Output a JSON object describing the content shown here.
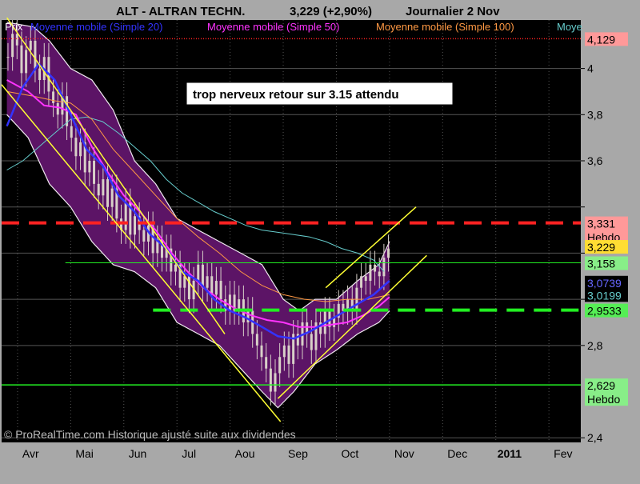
{
  "header": {
    "title": "ALT - ALTRAN TECHN.",
    "price": "3,229 (+2,90%)",
    "period": "Journalier  2 Nov"
  },
  "legend": [
    {
      "label": "Prix",
      "color": "#ffffff"
    },
    {
      "label": "Moyenne mobile (Simple 20)",
      "color": "#3333ff"
    },
    {
      "label": "Moyenne mobile (Simple 50)",
      "color": "#ff33ff"
    },
    {
      "label": "Moyenne mobile (Simple 100)",
      "color": "#ff9944"
    },
    {
      "label": "Moye",
      "color": "#66cccc"
    }
  ],
  "annotation": "trop nerveux  retour sur 3.15 attendu",
  "footer": "© ProRealTime.com Historique ajusté suite aux dividendes",
  "colors": {
    "background": "#000000",
    "frame": "#a8a8a8",
    "bollinger_fill": "#5c1466",
    "candle": "#d8d0c8",
    "ma20": "#3333ff",
    "ma50": "#ff33ff",
    "ma100": "#ff9944",
    "ma_other": "#66cccc",
    "resistance": "#ff2222",
    "support": "#22ee22",
    "channel": "#ffff33",
    "grid": "#555555"
  },
  "chart_data": {
    "type": "candlestick",
    "x_labels": [
      {
        "label": "Avr",
        "pos": 0.0
      },
      {
        "label": "Mai",
        "pos": 1.0
      },
      {
        "label": "Jun",
        "pos": 2.0
      },
      {
        "label": "Jul",
        "pos": 3.0
      },
      {
        "label": "Aou",
        "pos": 4.0
      },
      {
        "label": "Sep",
        "pos": 5.0
      },
      {
        "label": "Oct",
        "pos": 6.0
      },
      {
        "label": "Nov",
        "pos": 7.0
      },
      {
        "label": "Dec",
        "pos": 8.0
      },
      {
        "label": "2011",
        "pos": 9.0,
        "bold": true
      },
      {
        "label": "Fev",
        "pos": 10.0
      }
    ],
    "x_range": [
      -0.3,
      10.6
    ],
    "y_ticks": [
      {
        "value": 2.4,
        "label": "2,4"
      },
      {
        "value": 2.8,
        "label": "2,8"
      },
      {
        "value": 3.0,
        "label": ""
      },
      {
        "value": 3.2,
        "label": ""
      },
      {
        "value": 3.4,
        "label": ""
      },
      {
        "value": 3.6,
        "label": "3,6"
      },
      {
        "value": 3.8,
        "label": "3,8"
      },
      {
        "value": 4.0,
        "label": "4"
      }
    ],
    "ylim": [
      2.38,
      4.21
    ],
    "price_tags": [
      {
        "value": 4.129,
        "label": "4,129",
        "bg": "#ff9999",
        "fg": "#000000"
      },
      {
        "value": 3.331,
        "label": "3,331\nHebdo",
        "bg": "#ff9999",
        "fg": "#000000"
      },
      {
        "value": 3.229,
        "label": "3,229",
        "bg": "#ffdd33",
        "fg": "#000000"
      },
      {
        "value": 3.158,
        "label": "3,158",
        "bg": "#88ee88",
        "fg": "#000000"
      },
      {
        "value": 3.0739,
        "label": "3,0739",
        "bg": "#000000",
        "fg": "#6666ff"
      },
      {
        "value": 3.0199,
        "label": "3,0199",
        "bg": "#000000",
        "fg": "#66cccc"
      },
      {
        "value": 2.9533,
        "label": "2,9533",
        "bg": "#55ee55",
        "fg": "#000000"
      },
      {
        "value": 2.629,
        "label": "2,629\nHebdo",
        "bg": "#88ee88",
        "fg": "#000000"
      }
    ],
    "resistance_level": 3.331,
    "support_level": 2.9533,
    "level_3158": 3.158,
    "level_2629": 2.629,
    "upper_bar_level": 4.129,
    "bb_upper": [
      [
        -0.2,
        4.2
      ],
      [
        0.3,
        4.18
      ],
      [
        0.6,
        4.12
      ],
      [
        1.0,
        4.0
      ],
      [
        1.4,
        3.95
      ],
      [
        1.8,
        3.82
      ],
      [
        2.2,
        3.6
      ],
      [
        2.6,
        3.5
      ],
      [
        3.0,
        3.35
      ],
      [
        3.4,
        3.3
      ],
      [
        3.8,
        3.25
      ],
      [
        4.2,
        3.2
      ],
      [
        4.6,
        3.15
      ],
      [
        5.0,
        3.0
      ],
      [
        5.3,
        2.95
      ],
      [
        5.6,
        3.0
      ],
      [
        6.0,
        3.0
      ],
      [
        6.4,
        3.08
      ],
      [
        6.8,
        3.15
      ],
      [
        7.0,
        3.25
      ]
    ],
    "bb_lower": [
      [
        -0.2,
        3.8
      ],
      [
        0.2,
        3.7
      ],
      [
        0.6,
        3.5
      ],
      [
        1.0,
        3.4
      ],
      [
        1.4,
        3.25
      ],
      [
        1.8,
        3.15
      ],
      [
        2.2,
        3.12
      ],
      [
        2.6,
        3.05
      ],
      [
        3.0,
        2.9
      ],
      [
        3.4,
        2.85
      ],
      [
        3.8,
        2.8
      ],
      [
        4.2,
        2.7
      ],
      [
        4.6,
        2.6
      ],
      [
        4.9,
        2.53
      ],
      [
        5.2,
        2.6
      ],
      [
        5.6,
        2.72
      ],
      [
        6.0,
        2.78
      ],
      [
        6.4,
        2.85
      ],
      [
        6.8,
        2.9
      ],
      [
        7.0,
        2.95
      ]
    ],
    "ma20": [
      [
        -0.2,
        3.75
      ],
      [
        0.1,
        3.92
      ],
      [
        0.4,
        4.02
      ],
      [
        0.7,
        3.95
      ],
      [
        1.0,
        3.8
      ],
      [
        1.3,
        3.65
      ],
      [
        1.6,
        3.58
      ],
      [
        1.9,
        3.45
      ],
      [
        2.2,
        3.38
      ],
      [
        2.5,
        3.28
      ],
      [
        2.8,
        3.22
      ],
      [
        3.1,
        3.12
      ],
      [
        3.4,
        3.08
      ],
      [
        3.7,
        3.0
      ],
      [
        4.0,
        2.95
      ],
      [
        4.3,
        2.92
      ],
      [
        4.6,
        2.88
      ],
      [
        4.9,
        2.84
      ],
      [
        5.2,
        2.83
      ],
      [
        5.5,
        2.86
      ],
      [
        5.8,
        2.9
      ],
      [
        6.1,
        2.94
      ],
      [
        6.4,
        2.98
      ],
      [
        6.7,
        3.02
      ],
      [
        7.0,
        3.08
      ]
    ],
    "ma50": [
      [
        -0.2,
        3.95
      ],
      [
        0.2,
        3.9
      ],
      [
        0.5,
        3.84
      ],
      [
        0.8,
        3.83
      ],
      [
        1.1,
        3.8
      ],
      [
        1.4,
        3.66
      ],
      [
        1.7,
        3.55
      ],
      [
        2.0,
        3.45
      ],
      [
        2.3,
        3.38
      ],
      [
        2.6,
        3.3
      ],
      [
        2.9,
        3.2
      ],
      [
        3.2,
        3.12
      ],
      [
        3.5,
        3.05
      ],
      [
        3.8,
        3.0
      ],
      [
        4.1,
        2.96
      ],
      [
        4.4,
        2.93
      ],
      [
        4.7,
        2.91
      ],
      [
        5.0,
        2.9
      ],
      [
        5.3,
        2.88
      ],
      [
        5.6,
        2.88
      ],
      [
        5.9,
        2.89
      ],
      [
        6.2,
        2.9
      ],
      [
        6.5,
        2.93
      ],
      [
        6.8,
        2.97
      ],
      [
        7.0,
        3.01
      ]
    ],
    "ma100": [
      [
        -0.2,
        3.9
      ],
      [
        0.3,
        3.88
      ],
      [
        0.7,
        3.86
      ],
      [
        1.0,
        3.85
      ],
      [
        1.4,
        3.78
      ],
      [
        1.8,
        3.65
      ],
      [
        2.2,
        3.55
      ],
      [
        2.6,
        3.45
      ],
      [
        3.0,
        3.35
      ],
      [
        3.4,
        3.27
      ],
      [
        3.8,
        3.2
      ],
      [
        4.2,
        3.12
      ],
      [
        4.6,
        3.06
      ],
      [
        5.0,
        3.02
      ],
      [
        5.4,
        3.0
      ],
      [
        5.8,
        2.99
      ],
      [
        6.2,
        3.0
      ],
      [
        6.6,
        3.0
      ],
      [
        7.0,
        3.02
      ]
    ],
    "ma_other": [
      [
        -0.2,
        3.56
      ],
      [
        0.1,
        3.6
      ],
      [
        0.4,
        3.66
      ],
      [
        0.7,
        3.72
      ],
      [
        1.0,
        3.78
      ],
      [
        1.3,
        3.79
      ],
      [
        1.6,
        3.77
      ],
      [
        1.9,
        3.72
      ],
      [
        2.2,
        3.66
      ],
      [
        2.5,
        3.6
      ],
      [
        2.8,
        3.52
      ],
      [
        3.1,
        3.46
      ],
      [
        3.4,
        3.42
      ],
      [
        3.7,
        3.38
      ],
      [
        4.0,
        3.35
      ],
      [
        4.3,
        3.32
      ],
      [
        4.6,
        3.3
      ],
      [
        4.9,
        3.29
      ],
      [
        5.2,
        3.28
      ],
      [
        5.5,
        3.27
      ],
      [
        5.8,
        3.25
      ],
      [
        6.1,
        3.22
      ],
      [
        6.4,
        3.2
      ],
      [
        6.7,
        3.17
      ],
      [
        6.9,
        3.12
      ]
    ],
    "closes": [
      4.05,
      4.15,
      4.1,
      3.98,
      4.08,
      4.12,
      4.0,
      3.95,
      4.05,
      3.9,
      3.85,
      3.8,
      3.88,
      3.75,
      3.7,
      3.62,
      3.68,
      3.55,
      3.6,
      3.5,
      3.45,
      3.52,
      3.4,
      3.48,
      3.35,
      3.3,
      3.42,
      3.28,
      3.36,
      3.3,
      3.25,
      3.32,
      3.2,
      3.26,
      3.18,
      3.22,
      3.12,
      3.15,
      3.05,
      3.1,
      3.0,
      3.08,
      3.15,
      3.05,
      3.1,
      3.02,
      3.08,
      3.0,
      2.95,
      3.02,
      2.95,
      3.0,
      2.9,
      2.95,
      2.85,
      2.8,
      2.75,
      2.7,
      2.6,
      2.68,
      2.75,
      2.8,
      2.72,
      2.85,
      2.8,
      2.9,
      2.85,
      2.78,
      2.9,
      2.85,
      2.95,
      2.88,
      2.92,
      2.98,
      2.95,
      3.0,
      2.95,
      3.05,
      3.1,
      3.08,
      3.15,
      3.12,
      3.1,
      3.18,
      3.22
    ],
    "channel_down": {
      "upper": [
        [
          -0.2,
          4.22
        ],
        [
          3.9,
          2.85
        ]
      ],
      "lower": [
        [
          -0.3,
          3.93
        ],
        [
          4.95,
          2.47
        ]
      ]
    },
    "channel_up": {
      "upper": [
        [
          5.8,
          3.05
        ],
        [
          7.5,
          3.4
        ]
      ],
      "lower": [
        [
          4.9,
          2.57
        ],
        [
          7.7,
          3.19
        ]
      ]
    }
  }
}
